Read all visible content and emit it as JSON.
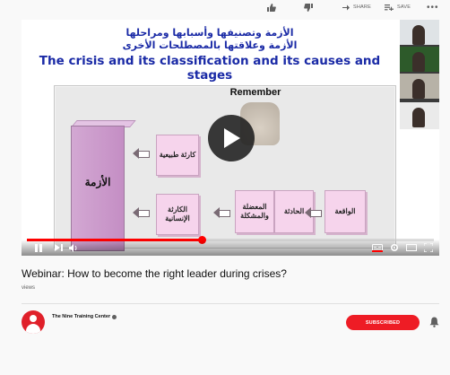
{
  "slide": {
    "title_line1": "الأزمة وتصنيفها وأسبابها ومراحلها",
    "title_line2": "الأزمة وعلاقتها بالمصطلحات الأخرى",
    "title_line3": "The crisis and its classification and its causes and stages",
    "remember": "Remember",
    "prism_label": "الأزمة",
    "node_natural": "كارثة طبيعية",
    "node_human": "الكارثة الإنسانية",
    "node_problem": "المعضلة والمشكلة",
    "node_incident": "الحادثة",
    "node_fact": "الواقعة"
  },
  "player": {
    "progress_fraction": 0.43,
    "accent_color": "#ff0000",
    "icons": [
      "play-icon",
      "pause-icon",
      "next-icon",
      "volume-icon",
      "captions-icon",
      "settings-icon",
      "theater-icon",
      "fullscreen-icon"
    ]
  },
  "video": {
    "title": "Webinar: How to become the right leader during crises?",
    "views": "views"
  },
  "actions": {
    "share_label": "SHARE",
    "save_label": "SAVE",
    "more_label": "•••"
  },
  "channel": {
    "name": "The Nine Training Center",
    "subscribe_label": "SUBSCRIBED",
    "subscribe_color": "#ee1c25"
  }
}
